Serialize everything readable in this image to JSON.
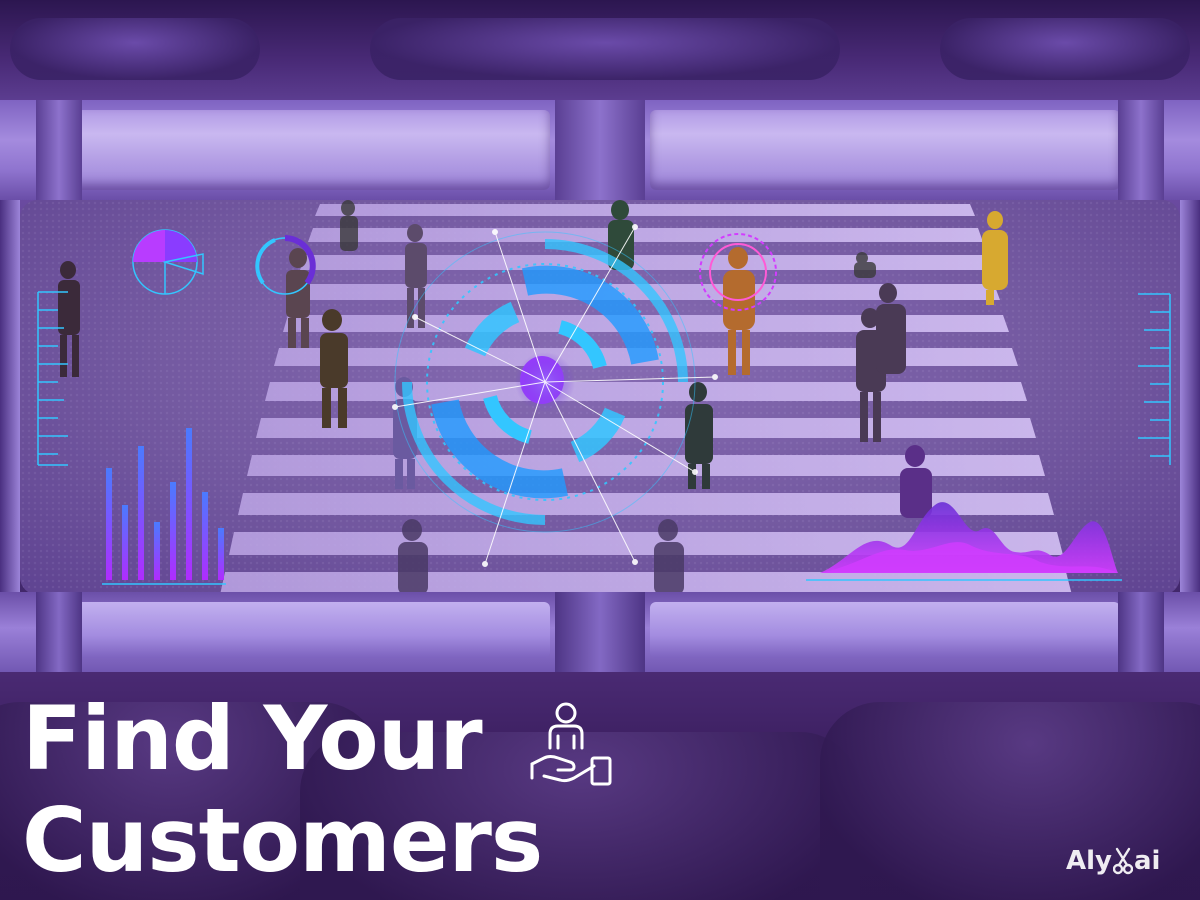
{
  "headline": {
    "line1": "Find Your",
    "line2": "Customers"
  },
  "brand": {
    "logo_prefix": "Aly",
    "logo_suffix": "ai"
  },
  "icons": {
    "headline_icon": "customer-in-hand-icon"
  },
  "colors": {
    "background": "#3a1d5c",
    "frame": "#a48bde",
    "hud_cyan": "#33c6ff",
    "hud_magenta": "#d23cff",
    "hud_purple": "#6a2fd6",
    "title_text": "#ffffff"
  }
}
